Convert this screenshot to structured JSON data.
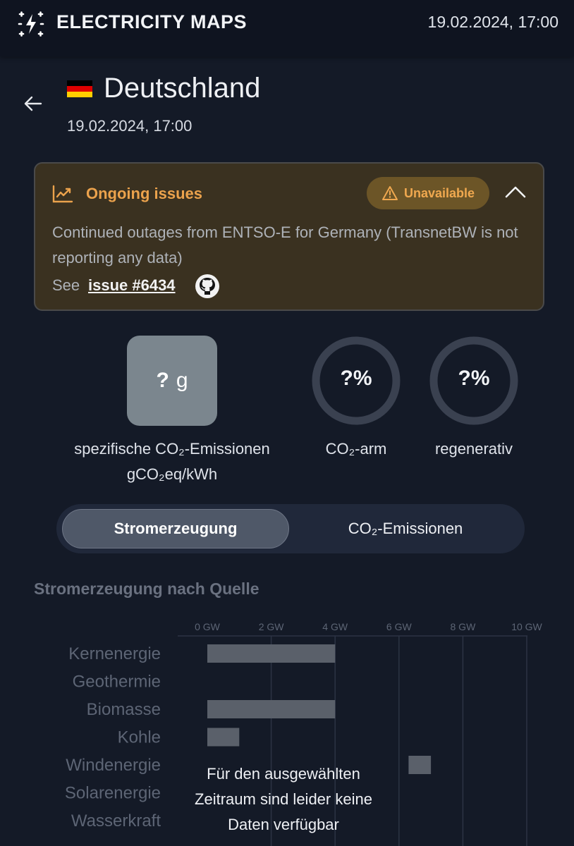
{
  "header": {
    "brand": "ELECTRICITY MAPS",
    "datetime": "19.02.2024, 17:00"
  },
  "zone": {
    "name": "Deutschland",
    "datetime": "19.02.2024, 17:00",
    "flag_colors": [
      "#000000",
      "#dd0000",
      "#ffce00"
    ]
  },
  "issue": {
    "title": "Ongoing issues",
    "badge": "Unavailable",
    "message": "Continued outages from ENTSO-E for Germany (TransnetBW is not reporting any data)",
    "see_label": "See",
    "link_label": "issue #6434"
  },
  "indicators": {
    "carbon_value": "?",
    "carbon_unit": "g",
    "carbon_label": "spezifische CO₂-Emissionen",
    "carbon_unit_label": "gCO₂eq/kWh",
    "lowcarbon_value": "?%",
    "lowcarbon_label": "CO₂-arm",
    "renewable_value": "?%",
    "renewable_label": "regenerativ"
  },
  "toggle": {
    "active": "Stromerzeugung",
    "other": "CO₂-Emissionen"
  },
  "section": {
    "title": "Stromerzeugung nach Quelle"
  },
  "colors": {
    "background": "#141a27",
    "accent_warning": "#eba24c",
    "bar": "#5a606a"
  },
  "chart_data": {
    "type": "bar",
    "orientation": "horizontal",
    "x_ticks": [
      "0 GW",
      "2 GW",
      "4 GW",
      "6 GW",
      "8 GW",
      "10 GW"
    ],
    "xlim": [
      0,
      10
    ],
    "unit": "GW",
    "categories": [
      "Kernenergie",
      "Geothermie",
      "Biomasse",
      "Kohle",
      "Windenergie",
      "Solarenergie",
      "Wasserkraft"
    ],
    "bars": [
      {
        "category": "Kernenergie",
        "start": 0,
        "end": 4
      },
      {
        "category": "Biomasse",
        "start": 0,
        "end": 4
      },
      {
        "category": "Kohle",
        "start": 0,
        "end": 1
      },
      {
        "category": "Windenergie",
        "start": 6.3,
        "end": 7
      }
    ],
    "grid": true,
    "no_data_message": "Für den ausgewählten Zeitraum sind leider keine Daten verfügbar"
  }
}
